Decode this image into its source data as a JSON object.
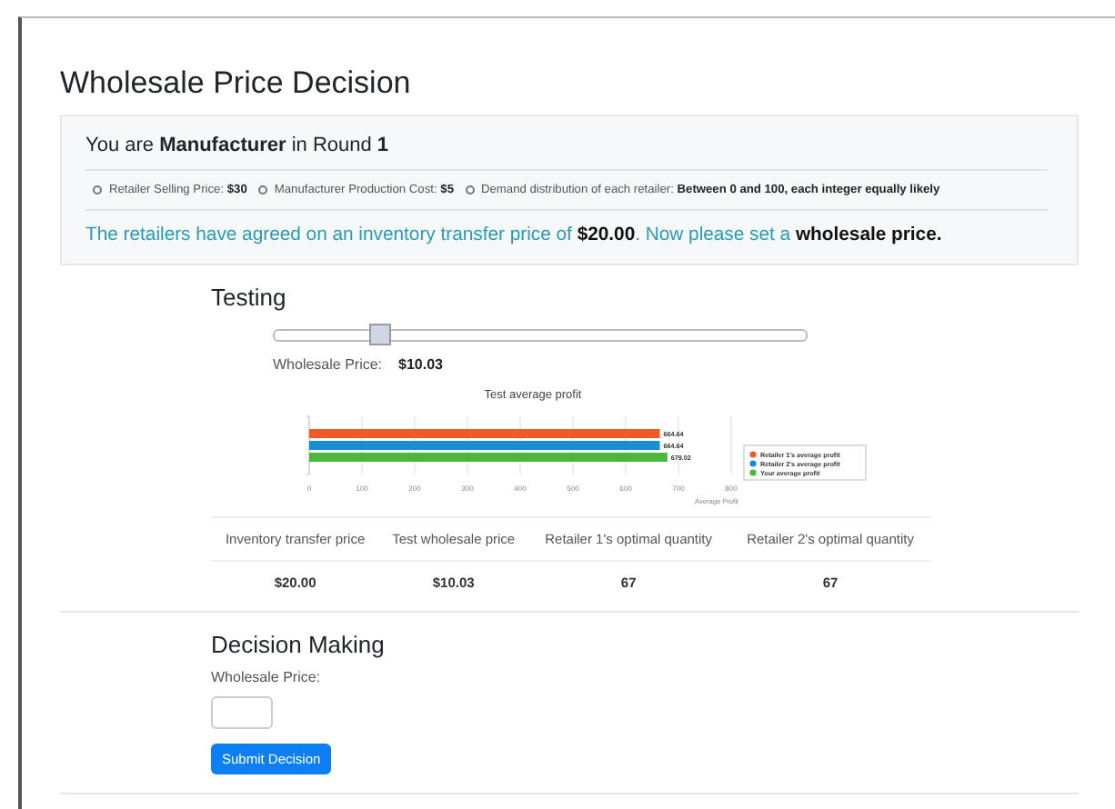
{
  "title": "Wholesale Price Decision",
  "info": {
    "role_line": "You are **Manufacturer** in Round **1**",
    "facts": [
      "Retailer Selling Price: **$30**",
      "Manufacturer Production Cost: **$5**",
      "Demand distribution of each retailer: **Between 0 and 100, each integer equally likely**"
    ],
    "notice": "The retailers have agreed on an inventory transfer price of **$20.00**. Now please set a **wholesale price.**"
  },
  "testing": {
    "heading": "Testing",
    "slider": {
      "level": 0.2
    },
    "price_label": "Wholesale Price:",
    "price_value": "$10.03",
    "chart_data": {
      "type": "bar",
      "orientation": "horizontal",
      "title": "Test average profit",
      "xlabel": "Average Profit",
      "xlim": [
        0,
        800
      ],
      "xticks": [
        0,
        100,
        200,
        300,
        400,
        500,
        600,
        700,
        800
      ],
      "data_labels": true,
      "grid": true,
      "legend": true,
      "series": [
        {
          "name": "Retailer 1's average profit",
          "color": "#f05a28",
          "values": [
            664.64
          ]
        },
        {
          "name": "Retailer 2's average profit",
          "color": "#1a8fd0",
          "values": [
            664.64
          ]
        },
        {
          "name": "Your average profit",
          "color": "#4cb640",
          "values": [
            679.02
          ]
        }
      ]
    },
    "table": {
      "columns": [
        "Inventory transfer price",
        "Test wholesale price",
        "Retailer 1's optimal quantity",
        "Retailer 2's optimal quantity"
      ],
      "rows": [
        [
          "$20.00",
          "$10.03",
          "67",
          "67"
        ]
      ]
    }
  },
  "decision": {
    "heading": "Decision Making",
    "field_label": "Wholesale Price:",
    "button": "Submit Decision"
  }
}
